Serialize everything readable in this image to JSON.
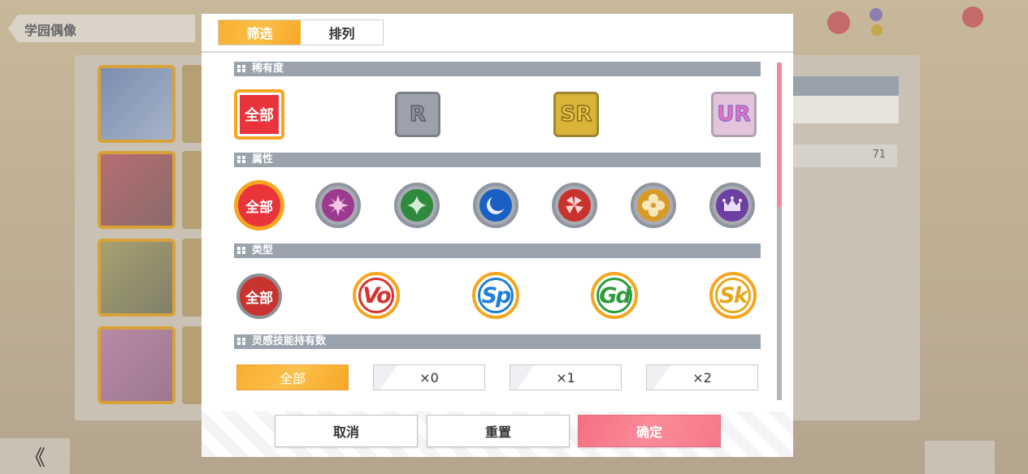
{
  "background": {
    "header_title": "学园偶像",
    "back_label": "《",
    "table_value": "71"
  },
  "modal": {
    "tabs": [
      {
        "label": "筛选",
        "active": true
      },
      {
        "label": "排列",
        "active": false
      }
    ],
    "sections": {
      "rarity": {
        "title": "稀有度",
        "options": [
          {
            "label": "全部",
            "selected": true
          },
          {
            "label": "R"
          },
          {
            "label": "SR"
          },
          {
            "label": "UR"
          }
        ]
      },
      "attribute": {
        "title": "属性",
        "options": [
          {
            "label": "全部",
            "selected": true,
            "icon": "all-icon"
          },
          {
            "icon": "smile-attribute-icon",
            "color": "#9d3a8f"
          },
          {
            "icon": "pure-attribute-icon",
            "color": "#2f8a3d"
          },
          {
            "icon": "cool-attribute-icon",
            "color": "#1a5fc2"
          },
          {
            "icon": "active-attribute-icon",
            "color": "#c8322f"
          },
          {
            "icon": "natural-attribute-icon",
            "color": "#d69a25"
          },
          {
            "icon": "elegant-attribute-icon",
            "color": "#6e3fa2"
          }
        ]
      },
      "type": {
        "title": "类型",
        "options": [
          {
            "label": "全部"
          },
          {
            "label": "Vo",
            "color": "#d6332f"
          },
          {
            "label": "Sp",
            "color": "#1e7fd3"
          },
          {
            "label": "Gd",
            "color": "#2e9b3c"
          },
          {
            "label": "Sk",
            "color": "#e4a81d"
          }
        ]
      },
      "inspiration": {
        "title": "灵感技能持有数",
        "options": [
          {
            "label": "全部",
            "selected": true
          },
          {
            "label": "×0"
          },
          {
            "label": "×1"
          },
          {
            "label": "×2"
          }
        ]
      }
    },
    "footer": {
      "cancel": "取消",
      "reset": "重置",
      "confirm": "确定"
    }
  },
  "colors": {
    "accent_orange": "#f7a51f",
    "confirm_pink": "#fb8b99",
    "section_bar": "#9aa2ae",
    "scroll_thumb": "#f08a98"
  }
}
